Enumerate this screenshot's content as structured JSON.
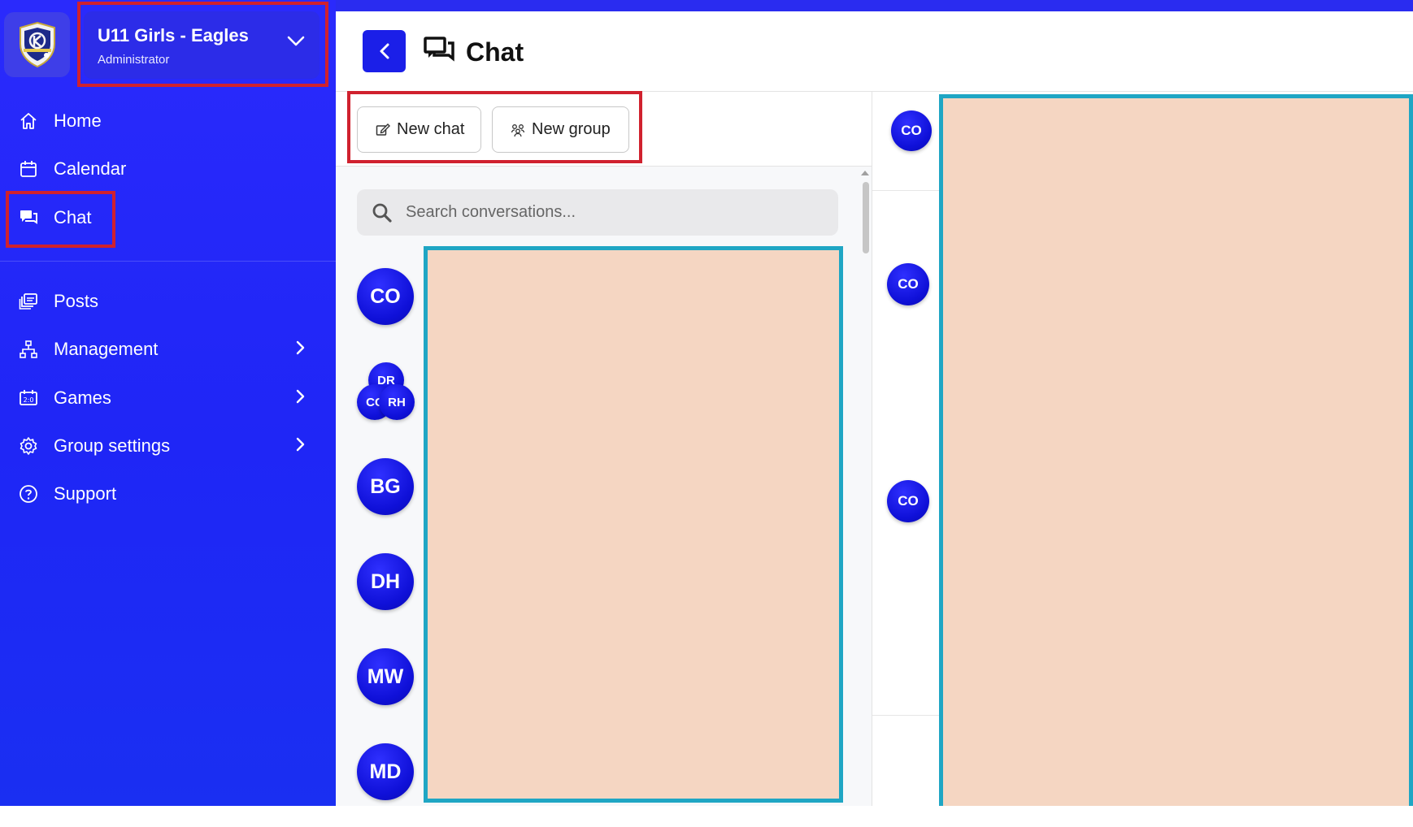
{
  "sidebar": {
    "team": {
      "name": "U11 Girls - Eagles",
      "role": "Administrator"
    },
    "items": [
      {
        "label": "Home",
        "icon": "home-icon"
      },
      {
        "label": "Calendar",
        "icon": "calendar-icon"
      },
      {
        "label": "Chat",
        "icon": "chat-icon"
      },
      {
        "label": "Posts",
        "icon": "posts-icon"
      },
      {
        "label": "Management",
        "icon": "management-icon",
        "has_submenu": true
      },
      {
        "label": "Games",
        "icon": "games-icon",
        "has_submenu": true
      },
      {
        "label": "Group settings",
        "icon": "gear-icon",
        "has_submenu": true
      },
      {
        "label": "Support",
        "icon": "help-icon"
      }
    ]
  },
  "header": {
    "title": "Chat"
  },
  "chat_list": {
    "new_chat_label": "New chat",
    "new_group_label": "New group",
    "search_placeholder": "Search conversations...",
    "conversations": [
      {
        "initials": "CO"
      },
      {
        "group_initials": [
          "DR",
          "CC",
          "RH"
        ]
      },
      {
        "initials": "BG"
      },
      {
        "initials": "DH"
      },
      {
        "initials": "MW"
      },
      {
        "initials": "MD"
      }
    ]
  },
  "conversation": {
    "header_avatar": "CO",
    "message_avatars": [
      "CO",
      "CO"
    ]
  },
  "colors": {
    "sidebar": "#2a2afc",
    "accent": "#1b1fe8",
    "highlight_red": "#d0212e",
    "redaction_fill": "#f5d6c2",
    "redaction_border": "#1fa6c4"
  }
}
